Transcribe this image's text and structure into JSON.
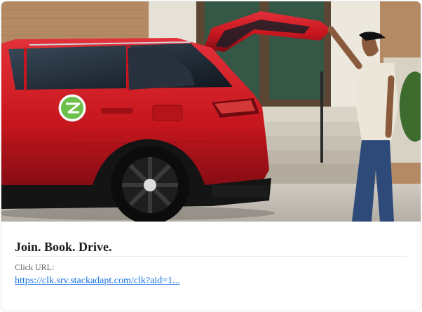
{
  "card": {
    "title": "Join. Book. Drive.",
    "url_label": "Click URL:",
    "url_text": "https://clk.srv.stackadapt.com/clk?aid=1...",
    "image_alt": "Red SUV with open tailgate and man standing behind it"
  },
  "colors": {
    "link": "#1a73e8",
    "title": "#1a1a1a",
    "car_red": "#c8161e",
    "zipcar_green": "#6cc04a"
  },
  "icons": {
    "brand_logo": "zipcar-logo-icon"
  }
}
